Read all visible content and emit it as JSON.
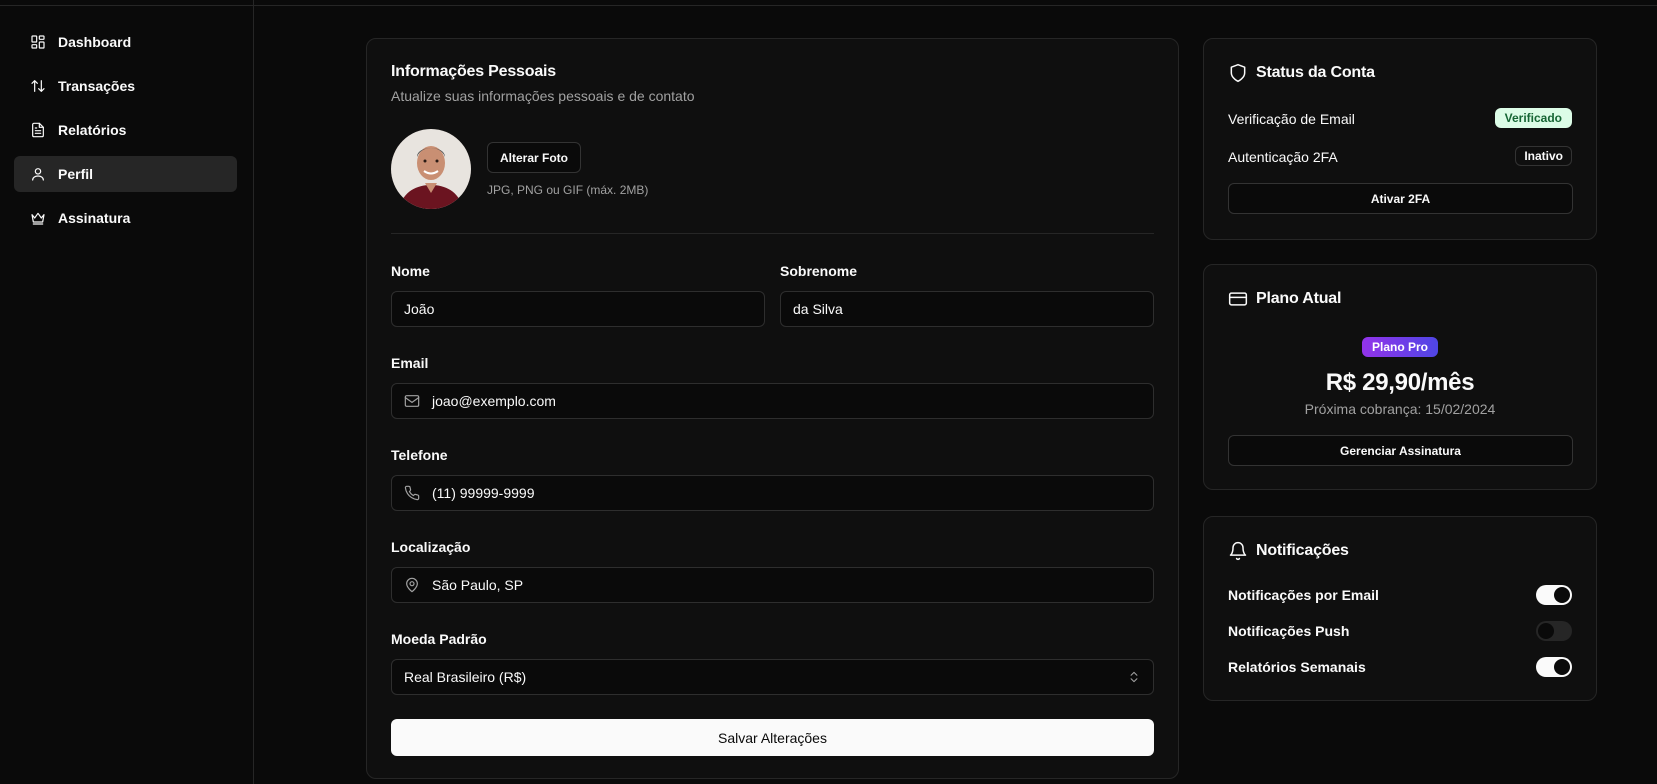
{
  "sidebar": {
    "items": [
      {
        "label": "Dashboard",
        "icon": "grid-icon"
      },
      {
        "label": "Transações",
        "icon": "arrows-up-down-icon"
      },
      {
        "label": "Relatórios",
        "icon": "file-text-icon"
      },
      {
        "label": "Perfil",
        "icon": "user-icon",
        "active": true
      },
      {
        "label": "Assinatura",
        "icon": "crown-icon"
      }
    ]
  },
  "personal": {
    "title": "Informações Pessoais",
    "subtitle": "Atualize suas informações pessoais e de contato",
    "change_photo_label": "Alterar Foto",
    "photo_hint": "JPG, PNG ou GIF (máx. 2MB)",
    "first_name": {
      "label": "Nome",
      "value": "João"
    },
    "last_name": {
      "label": "Sobrenome",
      "value": "da Silva"
    },
    "email": {
      "label": "Email",
      "value": "joao@exemplo.com",
      "icon": "mail-icon"
    },
    "phone": {
      "label": "Telefone",
      "value": "(11) 99999-9999",
      "icon": "phone-icon"
    },
    "location": {
      "label": "Localização",
      "value": "São Paulo, SP",
      "icon": "map-pin-icon"
    },
    "currency": {
      "label": "Moeda Padrão",
      "value": "Real Brasileiro (R$)"
    },
    "save_label": "Salvar Alterações"
  },
  "status": {
    "title": "Status da Conta",
    "email_verification": {
      "label": "Verificação de Email",
      "badge": "Verificado"
    },
    "two_factor": {
      "label": "Autenticação 2FA",
      "badge": "Inativo"
    },
    "activate_label": "Ativar 2FA"
  },
  "plan": {
    "title": "Plano Atual",
    "badge": "Plano Pro",
    "price": "R$ 29,90/mês",
    "next_charge": "Próxima cobrança: 15/02/2024",
    "manage_label": "Gerenciar Assinatura"
  },
  "notifications": {
    "title": "Notificações",
    "items": [
      {
        "label": "Notificações por Email",
        "enabled": true
      },
      {
        "label": "Notificações Push",
        "enabled": false
      },
      {
        "label": "Relatórios Semanais",
        "enabled": true
      }
    ]
  },
  "colors": {
    "background": "#0a0a0a",
    "card": "#0f0f0f",
    "border": "#262626",
    "verified_badge": "#dcfce7",
    "plan_badge_start": "#9333ea",
    "plan_badge_end": "#4f46e5"
  }
}
